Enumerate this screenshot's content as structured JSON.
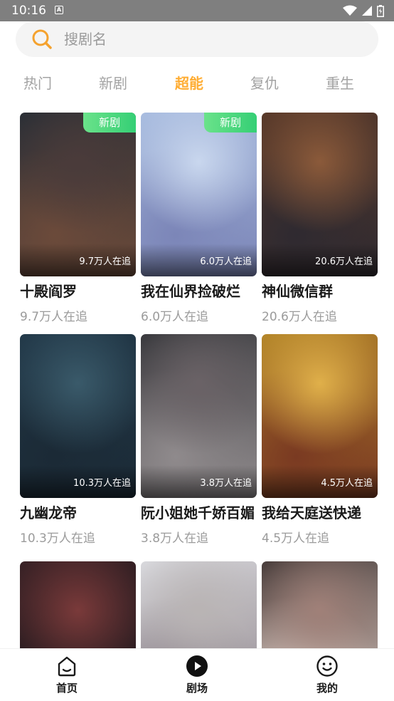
{
  "status_bar": {
    "time": "10:16",
    "notification_letter": "A"
  },
  "search": {
    "placeholder": "搜剧名"
  },
  "tabs": [
    {
      "label": "热门",
      "active": false
    },
    {
      "label": "新剧",
      "active": false
    },
    {
      "label": "超能",
      "active": true
    },
    {
      "label": "复仇",
      "active": false
    },
    {
      "label": "重生",
      "active": false
    }
  ],
  "shows": [
    {
      "title": "十殿阎罗",
      "followers": "9.7万人在追",
      "badge": "新剧",
      "poster_colors": [
        "#2b2f36",
        "#4a3b3a",
        "#6b4a3a"
      ]
    },
    {
      "title": "我在仙界捡破烂",
      "followers": "6.0万人在追",
      "badge": "新剧",
      "poster_colors": [
        "#a9bde0",
        "#c9d7ee",
        "#7c86b8"
      ]
    },
    {
      "title": "神仙微信群",
      "followers": "20.6万人在追",
      "badge": "",
      "poster_colors": [
        "#5a3a2a",
        "#8b5a3a",
        "#2f2a30"
      ]
    },
    {
      "title": "九幽龙帝",
      "followers": "10.3万人在追",
      "badge": "",
      "poster_colors": [
        "#233a4a",
        "#3a5a6a",
        "#1b2a36"
      ]
    },
    {
      "title": "阮小姐她千娇百媚",
      "followers": "3.8万人在追",
      "badge": "",
      "poster_colors": [
        "#3a3a3e",
        "#6a6266",
        "#8f8a8c"
      ]
    },
    {
      "title": "我给天庭送快递",
      "followers": "4.5万人在追",
      "badge": "",
      "poster_colors": [
        "#b5872a",
        "#e0b04a",
        "#7a3a22"
      ]
    },
    {
      "title": "",
      "followers": "",
      "badge": "",
      "poster_colors": [
        "#3a2226",
        "#7a3a3a",
        "#241a1e"
      ]
    },
    {
      "title": "",
      "followers": "",
      "badge": "",
      "poster_colors": [
        "#d8d8dc",
        "#b9b4b4",
        "#8a8088"
      ]
    },
    {
      "title": "",
      "followers": "",
      "badge": "",
      "poster_colors": [
        "#4a3e3c",
        "#a08078",
        "#d9c8c0"
      ]
    }
  ],
  "bottom_nav": {
    "items": [
      {
        "label": "首页",
        "icon": "home-icon"
      },
      {
        "label": "剧场",
        "icon": "play-icon"
      },
      {
        "label": "我的",
        "icon": "smiley-icon"
      }
    ]
  },
  "colors": {
    "accent": "#ffad33",
    "badge": "#3fd47b",
    "status_bar": "#7f7f7f"
  }
}
